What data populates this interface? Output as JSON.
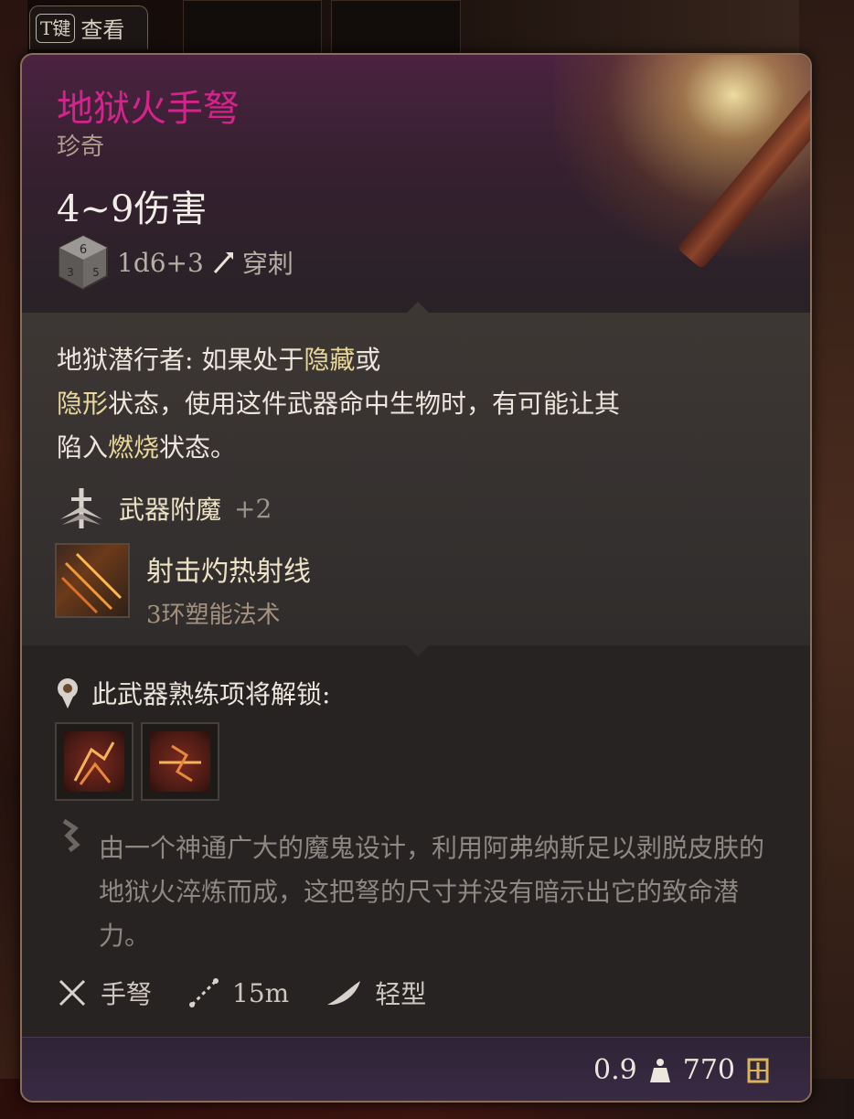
{
  "keyhint": {
    "key": "T键",
    "label": "查看"
  },
  "item": {
    "name": "地狱火手弩",
    "rarity": "珍奇",
    "damage": "4~9伤害",
    "damage_dice": "1d6+3",
    "damage_type": "穿刺"
  },
  "passive": {
    "name": "地狱潜行者:",
    "text_1": " 如果处于",
    "hl_1": "隐藏",
    "text_2": "或",
    "hl_2": "隐形",
    "text_3": "状态，使用这件武器命中生物时，有可能让其",
    "text_4": "陷入",
    "hl_3": "燃烧",
    "text_5": "状态。"
  },
  "enchant": {
    "label": "武器附魔",
    "value": "+2"
  },
  "spell": {
    "name": "射击灼热射线",
    "level": "3环塑能法术"
  },
  "proficiency": {
    "label": "此武器熟练项将解锁:"
  },
  "lore": "由一个神通广大的魔鬼设计，利用阿弗纳斯足以剥脱皮肤的地狱火淬炼而成，这把弩的尺寸并没有暗示出它的致命潜力。",
  "properties": {
    "type": "手弩",
    "range": "15m",
    "weight_class": "轻型"
  },
  "footer": {
    "weight": "0.9",
    "value": "770"
  },
  "colors": {
    "title": "#d4238a",
    "highlight": "#e8d69a",
    "border": "#8b6e5a"
  },
  "icons": [
    "dice-icon",
    "pierce-icon",
    "enchant-icon",
    "scorching-ray-icon",
    "proficiency-icon",
    "proficiency-action-icon-1",
    "proficiency-action-icon-2",
    "lore-icon",
    "crossed-swords-icon",
    "range-icon",
    "feather-icon",
    "weight-icon",
    "gold-icon"
  ]
}
